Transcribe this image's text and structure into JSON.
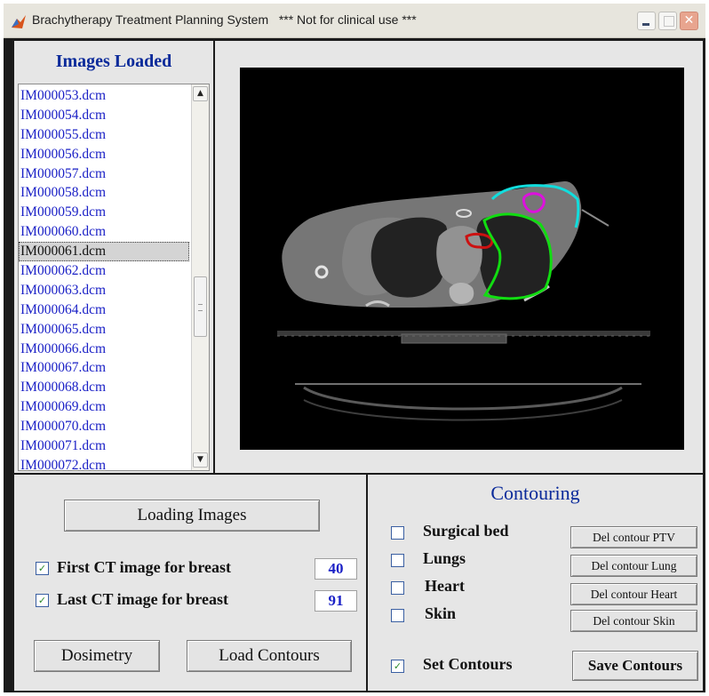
{
  "window": {
    "title": "Brachytherapy Treatment Planning System",
    "title_note": "*** Not for clinical use ***"
  },
  "images_panel": {
    "title": "Images  Loaded",
    "files": [
      "IM000053.dcm",
      "IM000054.dcm",
      "IM000055.dcm",
      "IM000056.dcm",
      "IM000057.dcm",
      "IM000058.dcm",
      "IM000059.dcm",
      "IM000060.dcm",
      "IM000061.dcm",
      "IM000062.dcm",
      "IM000063.dcm",
      "IM000064.dcm",
      "IM000065.dcm",
      "IM000066.dcm",
      "IM000067.dcm",
      "IM000068.dcm",
      "IM000069.dcm",
      "IM000070.dcm",
      "IM000071.dcm",
      "IM000072.dcm"
    ],
    "selected_file": "IM000061.dcm"
  },
  "ct_view": {
    "contour_colors": {
      "ptv": "#cc1111",
      "lung": "#11dd11",
      "heart": "#dd11dd",
      "skin": "#11dddd"
    }
  },
  "controls": {
    "loading_images_label": "Loading  Images",
    "first_ct_label": "First CT image for breast",
    "first_ct_value": "40",
    "first_ct_checked": true,
    "last_ct_label": "Last  CT image for breast",
    "last_ct_value": "91",
    "last_ct_checked": true,
    "dosimetry_label": "Dosimetry",
    "load_contours_label": "Load Contours"
  },
  "contouring": {
    "title": "Contouring",
    "structures": [
      {
        "label": "Surgical bed",
        "checked": false,
        "delete_label": "Del contour  PTV"
      },
      {
        "label": "Lungs",
        "checked": false,
        "delete_label": "Del contour Lung"
      },
      {
        "label": "Heart",
        "checked": false,
        "delete_label": "Del contour Heart"
      },
      {
        "label": "Skin",
        "checked": false,
        "delete_label": "Del contour Skin"
      }
    ],
    "set_contours_label": "Set Contours",
    "set_contours_checked": true,
    "save_contours_label": "Save Contours"
  }
}
